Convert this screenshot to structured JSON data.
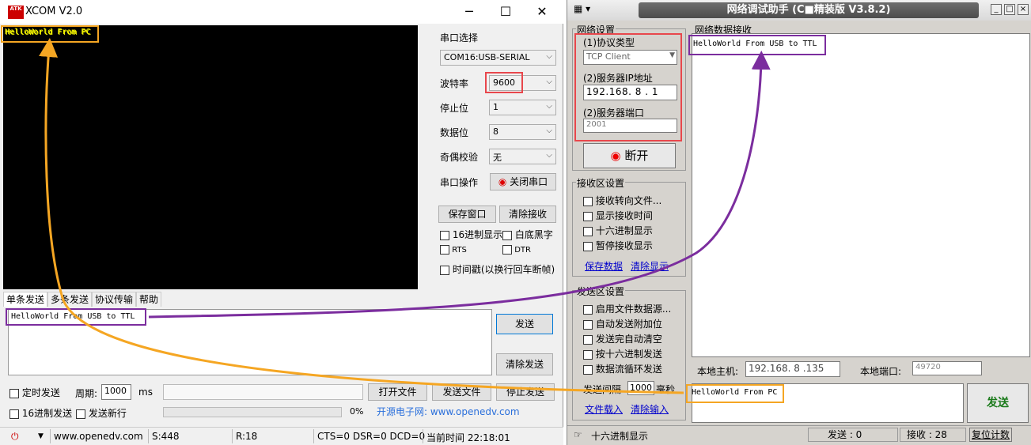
{
  "xcom": {
    "title": "XCOM V2.0",
    "logo": "ATK",
    "rx_text": "HelloWorld From PC",
    "port_label": "串口选择",
    "port_value": "COM16:USB-SERIAL",
    "baud_label": "波特率",
    "baud_value": "9600",
    "stop_label": "停止位",
    "stop_value": "1",
    "data_label": "数据位",
    "data_value": "8",
    "parity_label": "奇偶校验",
    "parity_value": "无",
    "op_label": "串口操作",
    "close_port": "关闭串口",
    "save_window": "保存窗口",
    "clear_rx": "清除接收",
    "hex_display": "16进制显示",
    "white_black": "白底黑字",
    "rts": "RTS",
    "dtr": "DTR",
    "timestamp": "时间戳(以换行回车断帧)",
    "tabs": [
      "单条发送",
      "多条发送",
      "协议传输",
      "帮助"
    ],
    "tx_text": "HelloWorld From USB to TTL",
    "send": "发送",
    "clear_send": "清除发送",
    "timed_send": "定时发送",
    "period_label": "周期:",
    "period_value": "1000",
    "ms": "ms",
    "open_file": "打开文件",
    "send_file": "发送文件",
    "stop_send": "停止发送",
    "hex_send": "16进制发送",
    "send_newline": "发送新行",
    "progress": "0%",
    "banner": "开源电子网: www.openedv.com",
    "status": {
      "url": "www.openedv.com",
      "sent": "S:448",
      "recv": "R:18",
      "lines": "CTS=0 DSR=0 DCD=0",
      "time": "当前时间 22:18:01"
    }
  },
  "net": {
    "title": "网络调试助手 (C■精装版 V3.8.2)",
    "net_settings": "网络设置",
    "proto_label": "(1)协议类型",
    "proto_value": "TCP Client",
    "ip_label": "(2)服务器IP地址",
    "ip_value": "192.168. 8 . 1",
    "port_label": "(2)服务器端口",
    "port_value": "2001",
    "disconnect": "断开",
    "rx_settings": "接收区设置",
    "rx_opts": [
      "接收转向文件...",
      "显示接收时间",
      "十六进制显示",
      "暂停接收显示"
    ],
    "save_data": "保存数据",
    "clear_display": "清除显示",
    "tx_settings": "发送区设置",
    "tx_opts": [
      "启用文件数据源...",
      "自动发送附加位",
      "发送完自动清空",
      "按十六进制发送",
      "数据流循环发送"
    ],
    "interval_label": "发送间隔",
    "interval_value": "1000",
    "interval_unit": "毫秒",
    "file_load": "文件载入",
    "clear_input": "清除输入",
    "rx_group": "网络数据接收",
    "rx_text": "HelloWorld From USB to TTL",
    "local_host_label": "本地主机:",
    "local_host_value": "192.168. 8 .135",
    "local_port_label": "本地端口:",
    "local_port_value": "49720",
    "tx_text": "HelloWorld From PC",
    "send": "发送",
    "hex_display": "十六进制显示",
    "sent_count": "发送 : 0",
    "recv_count": "接收 : 28",
    "reset_count": "复位计数"
  },
  "colors": {
    "orange": "#f5a623",
    "purple": "#7b2d9e",
    "red": "#e8474c"
  }
}
